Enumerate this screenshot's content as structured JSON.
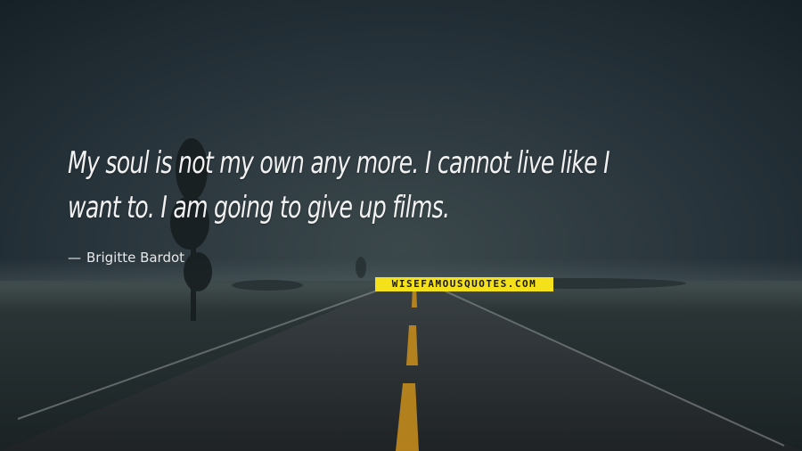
{
  "quote": {
    "line1": "My soul is not my own any more. I cannot live like I",
    "line2": "want to. I am going to give up films."
  },
  "author": {
    "dash": "—",
    "name": "Brigitte Bardot"
  },
  "watermark": {
    "text": "WISEFAMOUSQUOTES.COM"
  },
  "colors": {
    "sky_top": "#1e2a2f",
    "road": "#23282c",
    "center_line": "#c38a1d",
    "watermark_bg": "#f4e11b"
  }
}
